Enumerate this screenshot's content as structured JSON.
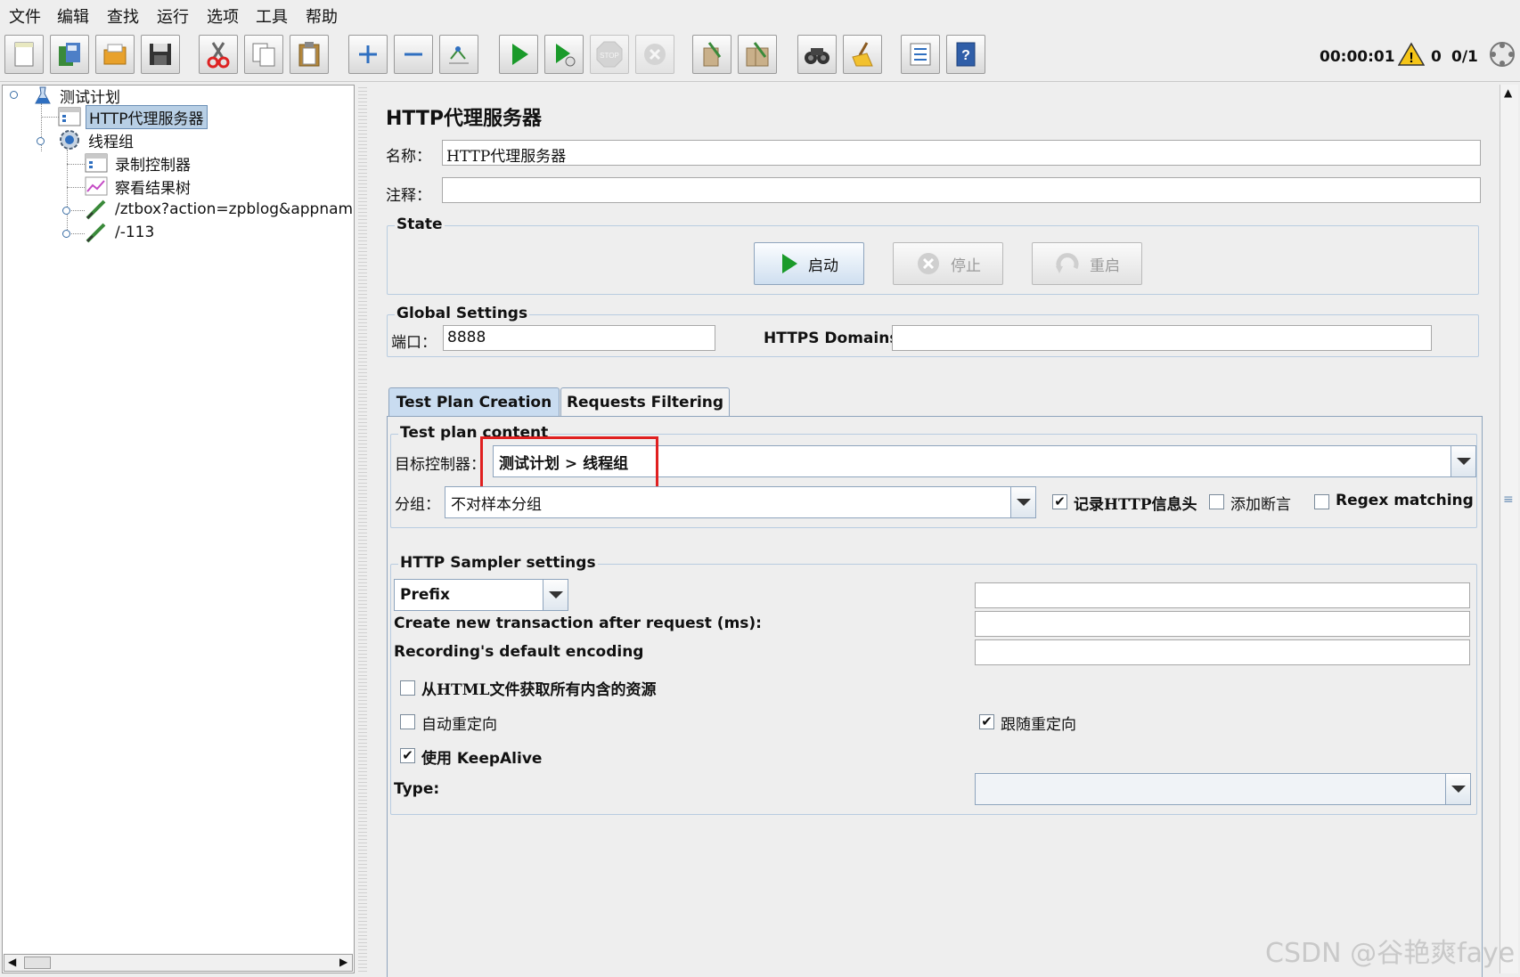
{
  "menu": [
    "文件",
    "编辑",
    "查找",
    "运行",
    "选项",
    "工具",
    "帮助"
  ],
  "toolbar": {
    "buttons": [
      "new-icon",
      "templates-icon",
      "open-icon",
      "save-icon",
      "cut-icon",
      "copy-icon",
      "paste-icon",
      "expand-icon",
      "collapse-icon",
      "toggle-icon",
      "start-icon",
      "start-no-pause-icon",
      "stop-icon",
      "shutdown-icon",
      "clear-icon",
      "clear-all-icon",
      "search-icon",
      "reset-search-icon",
      "function-helper-icon",
      "help-icon"
    ],
    "timer": "00:00:01",
    "warnings": "0",
    "threads": "0/1"
  },
  "tree": {
    "items": [
      {
        "label": "测试计划",
        "icon": "test-plan-icon"
      },
      {
        "label": "HTTP代理服务器",
        "icon": "proxy-icon"
      },
      {
        "label": "线程组",
        "icon": "thread-group-icon"
      },
      {
        "label": "录制控制器",
        "icon": "controller-icon"
      },
      {
        "label": "察看结果树",
        "icon": "results-icon"
      },
      {
        "label": "/ztbox?action=zpblog&appname=p",
        "icon": "sampler-icon"
      },
      {
        "label": "/-113",
        "icon": "sampler-icon"
      }
    ]
  },
  "panel": {
    "title": "HTTP代理服务器",
    "name_label": "名称：",
    "name_value": "HTTP代理服务器",
    "comment_label": "注释：",
    "comment_value": "",
    "state_title": "State",
    "start_label": "启动",
    "stop_label": "停止",
    "restart_label": "重启",
    "global_title": "Global Settings",
    "port_label": "端口：",
    "port_value": "8888",
    "https_label": "HTTPS Domains:",
    "https_value": "",
    "tabs": [
      "Test Plan Creation",
      "Requests Filtering"
    ],
    "content_title": "Test plan content",
    "target_label": "目标控制器：",
    "target_value": "测试计划 > 线程组",
    "grouping_label": "分组：",
    "grouping_value": "不对样本分组",
    "record_headers_label": "记录HTTP信息头",
    "add_assertions_label": "添加断言",
    "regex_label": "Regex matching",
    "sampler_title": "HTTP Sampler settings",
    "prefix_value": "Prefix",
    "prefix_field_value": "",
    "transaction_label": "Create new transaction after request (ms):",
    "encoding_label": "Recording's default encoding",
    "retrieve_resources_label": "从HTML文件获取所有内含的资源",
    "redirect_label": "自动重定向",
    "follow_redirect_label": "跟随重定向",
    "keepalive_label": "使用 KeepAlive",
    "type_label": "Type:",
    "type_value": ""
  },
  "checks": {
    "record_headers": true,
    "add_assertions": false,
    "regex": false,
    "retrieve_resources": false,
    "redirect": false,
    "follow_redirect": true,
    "keepalive": true
  },
  "watermark": "CSDN @谷艳爽faye"
}
